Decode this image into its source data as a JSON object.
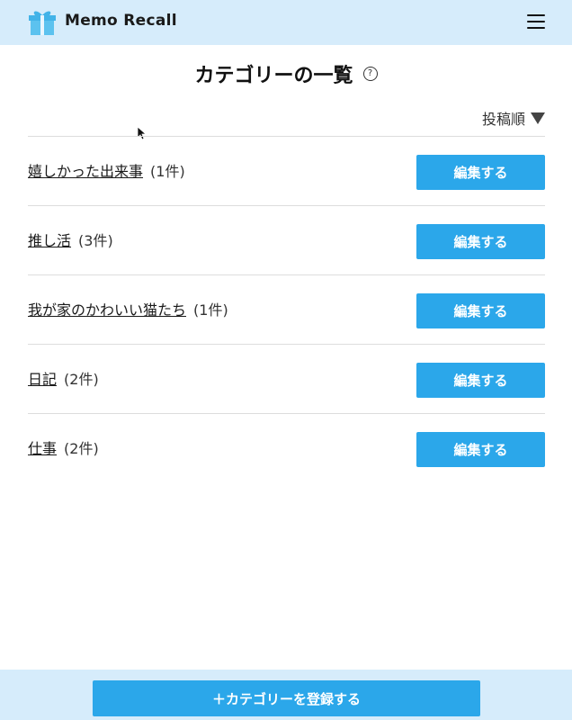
{
  "header": {
    "app_title": "Memo Recall",
    "logo_icon": "gift-box-icon",
    "menu_icon": "hamburger-menu-icon"
  },
  "main": {
    "title": "カテゴリーの一覧",
    "help_icon_glyph": "?",
    "sort": {
      "label": "投稿順",
      "icon": "triangle-down-icon"
    },
    "categories": [
      {
        "name": "嬉しかった出来事",
        "count": "(1件)",
        "edit_label": "編集する"
      },
      {
        "name": "推し活",
        "count": "(3件)",
        "edit_label": "編集する"
      },
      {
        "name": "我が家のかわいい猫たち",
        "count": "(1件)",
        "edit_label": "編集する"
      },
      {
        "name": "日記",
        "count": "(2件)",
        "edit_label": "編集する"
      },
      {
        "name": "仕事",
        "count": "(2件)",
        "edit_label": "編集する"
      }
    ]
  },
  "footer": {
    "register_label": "＋カテゴリーを登録する"
  },
  "colors": {
    "header_bg": "#d6ecfb",
    "accent": "#2ba7ea",
    "divider": "#dddddd"
  }
}
